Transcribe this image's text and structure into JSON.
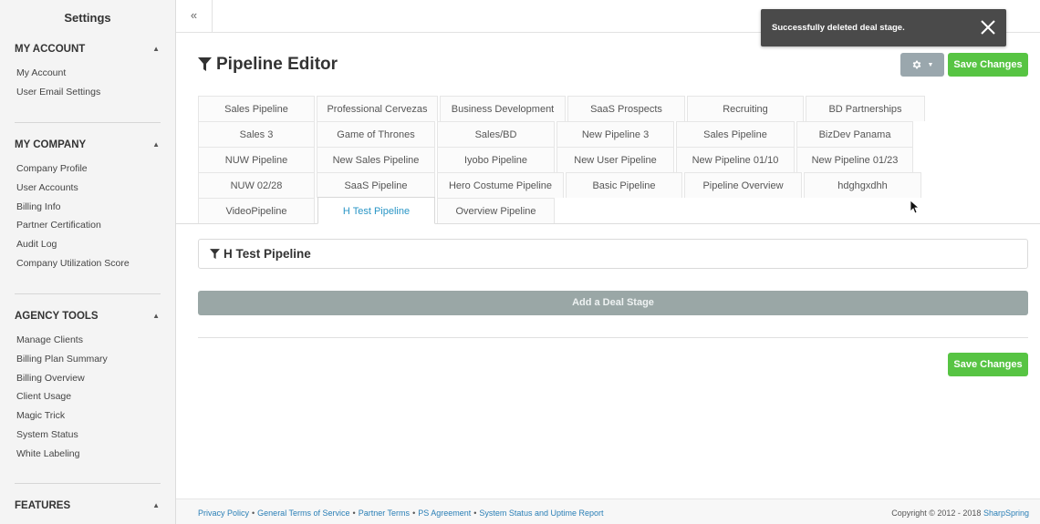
{
  "sidebar": {
    "title": "Settings",
    "sections": [
      {
        "heading": "MY ACCOUNT",
        "items": [
          "My Account",
          "User Email Settings"
        ]
      },
      {
        "heading": "MY COMPANY",
        "items": [
          "Company Profile",
          "User Accounts",
          "Billing Info",
          "Partner Certification",
          "Audit Log",
          "Company Utilization Score"
        ]
      },
      {
        "heading": "AGENCY TOOLS",
        "items": [
          "Manage Clients",
          "Billing Plan Summary",
          "Billing Overview",
          "Client Usage",
          "Magic Trick",
          "System Status",
          "White Labeling"
        ]
      },
      {
        "heading": "FEATURES",
        "items": []
      }
    ]
  },
  "topbar": {
    "collapse_glyph": "«"
  },
  "toast": {
    "message": "Successfully deleted deal stage."
  },
  "header": {
    "title": "Pipeline Editor",
    "save_label": "Save Changes",
    "gear_caret": "▼"
  },
  "tabs": {
    "rows": [
      [
        "Sales Pipeline",
        "Professional Cervezas",
        "Business Development",
        "SaaS Prospects",
        "Recruiting",
        "BD Partnerships"
      ],
      [
        "Sales 3",
        "Game of Thrones",
        "Sales/BD",
        "New Pipeline 3",
        "Sales Pipeline",
        "BizDev Panama"
      ],
      [
        "NUW Pipeline",
        "New Sales Pipeline",
        "Iyobo Pipeline",
        "New User Pipeline",
        "New Pipeline 01/10",
        "New Pipeline 01/23"
      ],
      [
        "NUW 02/28",
        "SaaS Pipeline",
        "Hero Costume Pipeline",
        "Basic Pipeline",
        "Pipeline Overview",
        "hdghgxdhh"
      ],
      [
        "VideoPipeline",
        "H Test Pipeline",
        "Overview Pipeline"
      ]
    ],
    "active": "H Test Pipeline"
  },
  "pipeline": {
    "name": "H Test Pipeline",
    "add_stage_label": "Add a Deal Stage",
    "save_label": "Save Changes"
  },
  "footer": {
    "links": [
      "Privacy Policy",
      "General Terms of Service",
      "Partner Terms",
      "PS Agreement",
      "System Status and Uptime Report"
    ],
    "separator": "•",
    "copyright_prefix": "Copyright © 2012 - 2018",
    "brand": "SharpSpring"
  },
  "colors": {
    "accent_blue": "#2a96c6",
    "save_green": "#57c443",
    "toast_bg": "#4a4a4a",
    "add_stage_bg": "#9aa7a6"
  }
}
